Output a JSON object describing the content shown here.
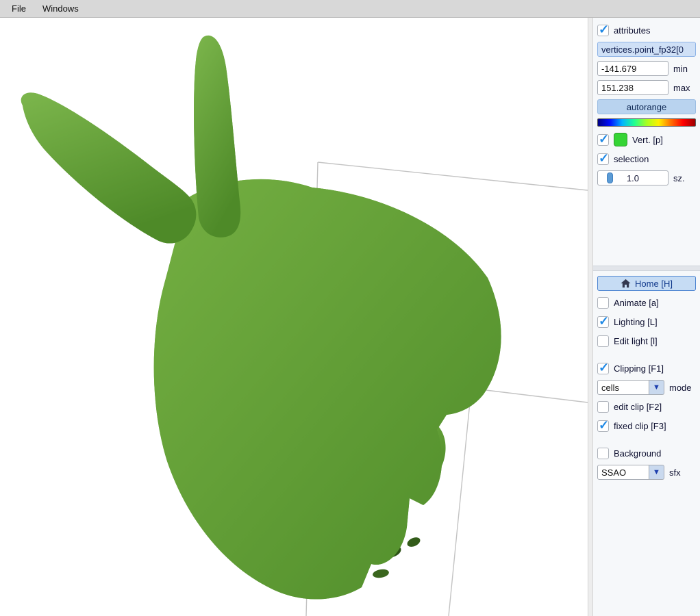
{
  "menubar": {
    "items": [
      {
        "label": "File"
      },
      {
        "label": "Windows"
      }
    ]
  },
  "attributes_panel": {
    "attributes_checkbox": {
      "label": "attributes",
      "checked": true
    },
    "attribute_field": {
      "value": "vertices.point_fp32[0"
    },
    "min_field": {
      "value": "-141.679",
      "label": "min"
    },
    "max_field": {
      "value": "151.238",
      "label": "max"
    },
    "autorange_button": {
      "label": "autorange"
    },
    "vert_checkbox": {
      "label": "Vert. [p]",
      "checked": true
    },
    "selection_checkbox": {
      "label": "selection",
      "checked": true
    },
    "size_slider": {
      "value": "1.0",
      "label": "sz."
    }
  },
  "view_panel": {
    "home_button": {
      "label": "Home [H]"
    },
    "animate_checkbox": {
      "label": "Animate [a]",
      "checked": false
    },
    "lighting_checkbox": {
      "label": "Lighting [L]",
      "checked": true
    },
    "edit_light_checkbox": {
      "label": "Edit light [l]",
      "checked": false
    },
    "clipping_checkbox": {
      "label": "Clipping [F1]",
      "checked": true
    },
    "clip_mode_select": {
      "value": "cells",
      "label": "mode"
    },
    "edit_clip_checkbox": {
      "label": "edit clip [F2]",
      "checked": false
    },
    "fixed_clip_checkbox": {
      "label": "fixed clip [F3]",
      "checked": true
    },
    "background_checkbox": {
      "label": "Background",
      "checked": false
    },
    "sfx_select": {
      "value": "SSAO",
      "label": "sfx"
    }
  },
  "colors": {
    "accent_blue": "#1e88e5",
    "point_color": "#35d435",
    "colormap": [
      "#000084",
      "#0010ff",
      "#00b4ff",
      "#20ff90",
      "#a8ff20",
      "#fff000",
      "#ff7000",
      "#ff0000",
      "#9c0000"
    ]
  }
}
